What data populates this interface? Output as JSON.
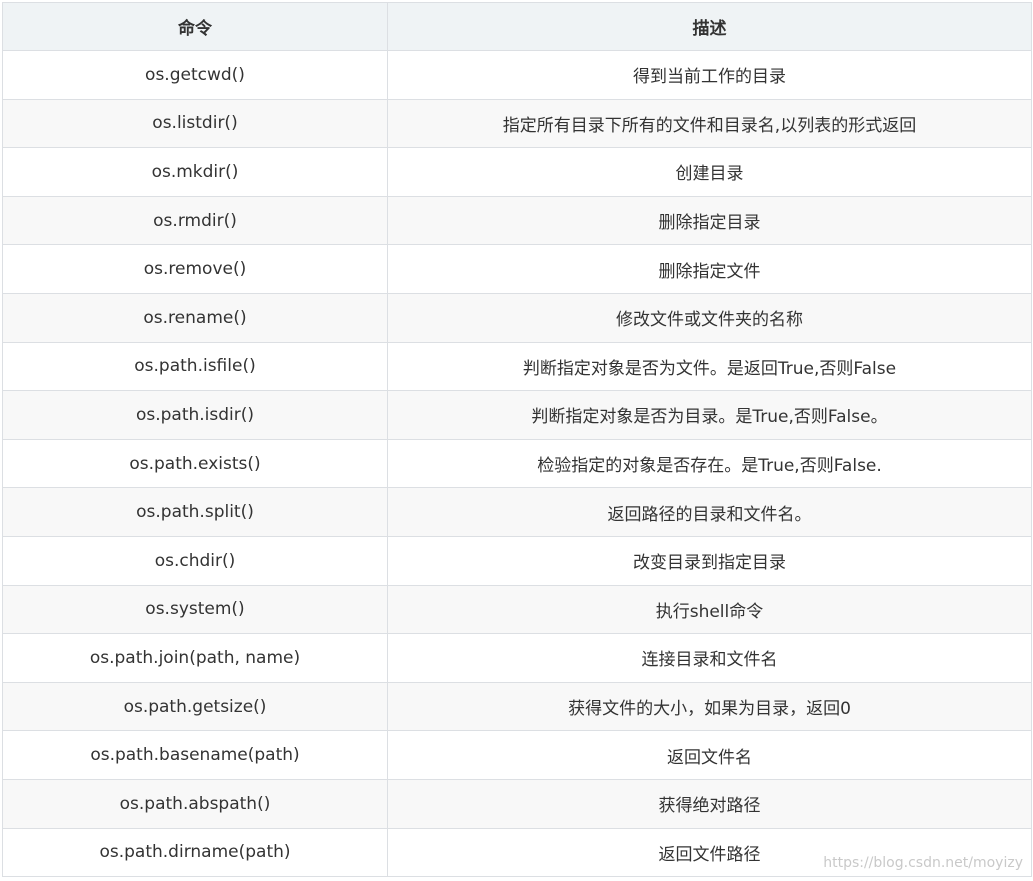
{
  "table": {
    "headers": [
      "命令",
      "描述"
    ],
    "rows": [
      {
        "command": "os.getcwd()",
        "description": "得到当前工作的目录"
      },
      {
        "command": "os.listdir()",
        "description": "指定所有目录下所有的文件和目录名,以列表的形式返回"
      },
      {
        "command": "os.mkdir()",
        "description": "创建目录"
      },
      {
        "command": "os.rmdir()",
        "description": "删除指定目录"
      },
      {
        "command": "os.remove()",
        "description": "删除指定文件"
      },
      {
        "command": "os.rename()",
        "description": "修改文件或文件夹的名称"
      },
      {
        "command": "os.path.isfile()",
        "description": "判断指定对象是否为文件。是返回True,否则False"
      },
      {
        "command": "os.path.isdir()",
        "description": "判断指定对象是否为目录。是True,否则False。"
      },
      {
        "command": "os.path.exists()",
        "description": "检验指定的对象是否存在。是True,否则False."
      },
      {
        "command": "os.path.split()",
        "description": "返回路径的目录和文件名。"
      },
      {
        "command": "os.chdir()",
        "description": "改变目录到指定目录"
      },
      {
        "command": "os.system()",
        "description": "执行shell命令"
      },
      {
        "command": "os.path.join(path, name)",
        "description": "连接目录和文件名"
      },
      {
        "command": "os.path.getsize()",
        "description": "获得文件的大小，如果为目录，返回0"
      },
      {
        "command": "os.path.basename(path)",
        "description": "返回文件名"
      },
      {
        "command": "os.path.abspath()",
        "description": "获得绝对路径"
      },
      {
        "command": "os.path.dirname(path)",
        "description": "返回文件路径"
      }
    ]
  },
  "watermark": "https://blog.csdn.net/moyizy"
}
